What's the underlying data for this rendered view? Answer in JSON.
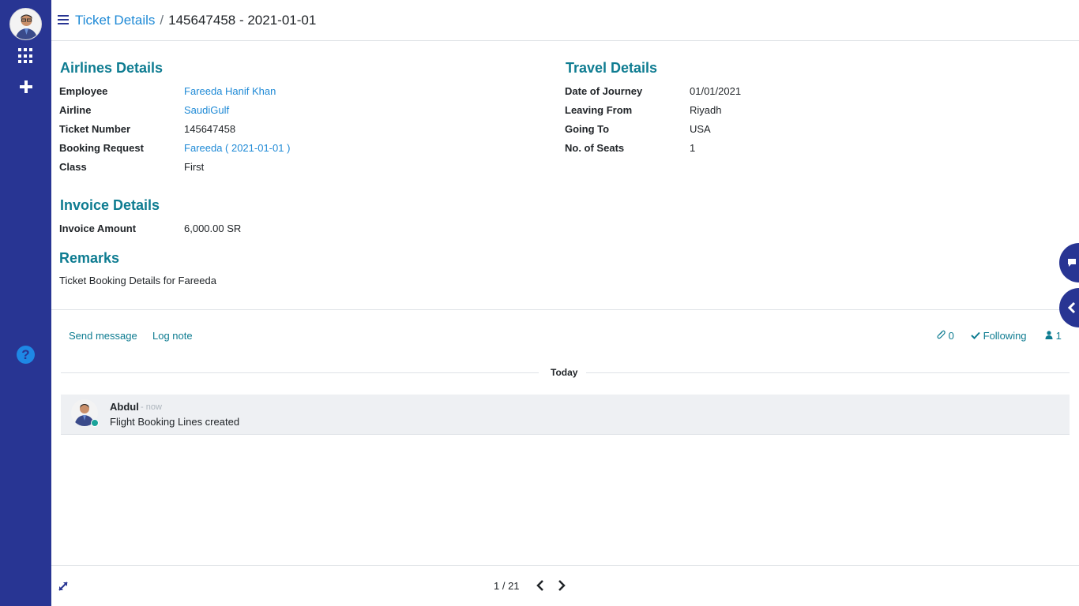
{
  "breadcrumb": {
    "parent": "Ticket Details",
    "separator": "/",
    "current": "145647458 - 2021-01-01"
  },
  "airlines": {
    "title": "Airlines Details",
    "fields": [
      {
        "label": "Employee",
        "value": "Fareeda Hanif Khan"
      },
      {
        "label": "Airline",
        "value": "SaudiGulf"
      },
      {
        "label": "Ticket Number",
        "value": "145647458"
      },
      {
        "label": "Booking Request",
        "value": "Fareeda ( 2021-01-01 )"
      },
      {
        "label": "Class",
        "value": "First"
      }
    ]
  },
  "travel": {
    "title": "Travel Details",
    "fields": [
      {
        "label": "Date of Journey",
        "value": "01/01/2021"
      },
      {
        "label": "Leaving From",
        "value": "Riyadh"
      },
      {
        "label": "Going To",
        "value": "USA"
      },
      {
        "label": "No. of Seats",
        "value": "1"
      }
    ]
  },
  "invoice": {
    "title": "Invoice Details",
    "label": "Invoice Amount",
    "value": "6,000.00 SR"
  },
  "remarks": {
    "title": "Remarks",
    "text": "Ticket Booking Details for Fareeda"
  },
  "chatter": {
    "send_message": "Send message",
    "log_note": "Log note",
    "attachments": "0",
    "following": "Following",
    "followers": "1",
    "date_separator": "Today",
    "message": {
      "author": "Abdul",
      "time": "- now",
      "body": "Flight Booking Lines created"
    }
  },
  "pager": {
    "value": "1 / 21"
  },
  "colors": {
    "sidebar": "#283593",
    "heading": "#0e7c91",
    "link": "#1f8ad6"
  }
}
